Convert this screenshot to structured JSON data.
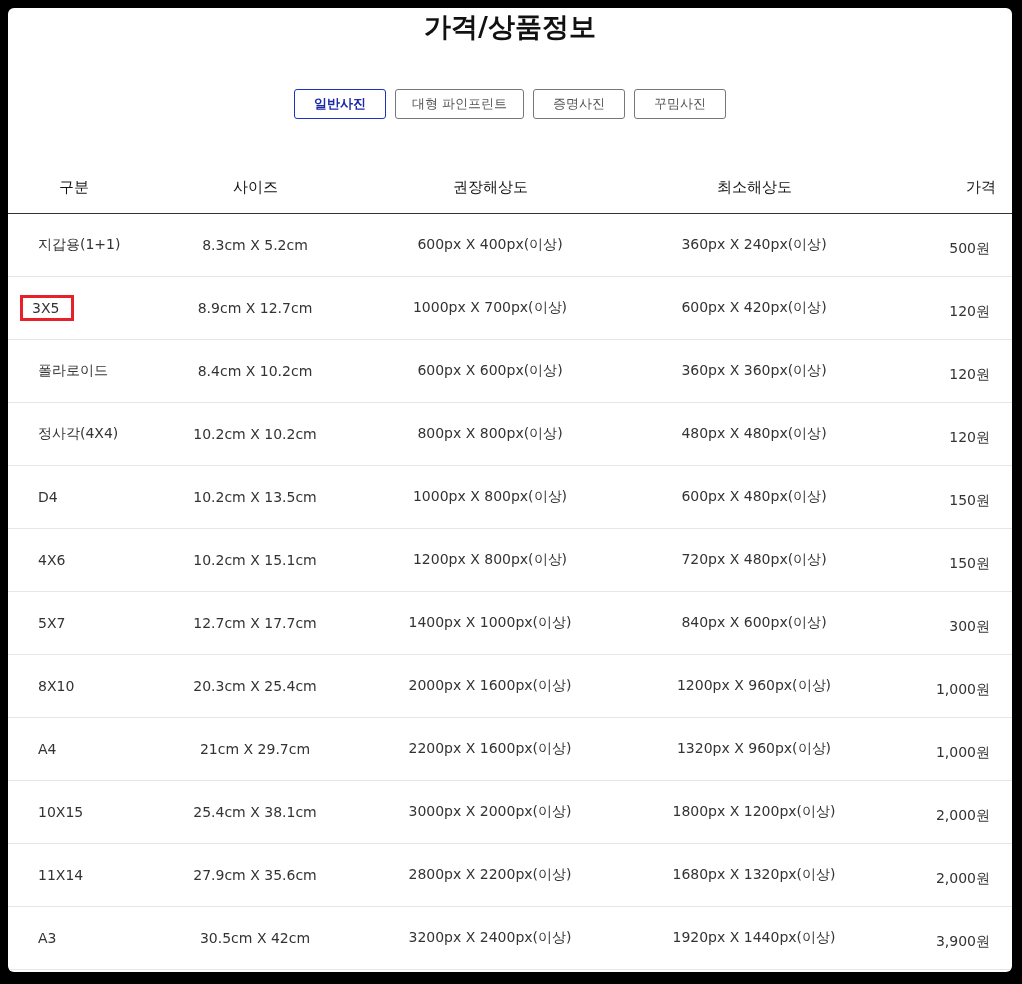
{
  "title": "가격/상품정보",
  "tabs": [
    {
      "label": "일반사진",
      "selected": true
    },
    {
      "label": "대형 파인프린트",
      "selected": false
    },
    {
      "label": "증명사진",
      "selected": false
    },
    {
      "label": "꾸밈사진",
      "selected": false
    }
  ],
  "table": {
    "columns": [
      "구분",
      "사이즈",
      "권장해상도",
      "최소해상도",
      "가격"
    ],
    "rows": [
      {
        "cells": [
          "지갑용(1+1)",
          "8.3cm X 5.2cm",
          "600px X 400px(이상)",
          "360px X 240px(이상)",
          "500원"
        ],
        "highlighted": false
      },
      {
        "cells": [
          "3X5",
          "8.9cm X 12.7cm",
          "1000px X 700px(이상)",
          "600px X 420px(이상)",
          "120원"
        ],
        "highlighted": true
      },
      {
        "cells": [
          "폴라로이드",
          "8.4cm X 10.2cm",
          "600px X 600px(이상)",
          "360px X 360px(이상)",
          "120원"
        ],
        "highlighted": false
      },
      {
        "cells": [
          "정사각(4X4)",
          "10.2cm X 10.2cm",
          "800px X 800px(이상)",
          "480px X 480px(이상)",
          "120원"
        ],
        "highlighted": false
      },
      {
        "cells": [
          "D4",
          "10.2cm X 13.5cm",
          "1000px X 800px(이상)",
          "600px X 480px(이상)",
          "150원"
        ],
        "highlighted": false
      },
      {
        "cells": [
          "4X6",
          "10.2cm X 15.1cm",
          "1200px X 800px(이상)",
          "720px X 480px(이상)",
          "150원"
        ],
        "highlighted": false
      },
      {
        "cells": [
          "5X7",
          "12.7cm X 17.7cm",
          "1400px X 1000px(이상)",
          "840px X 600px(이상)",
          "300원"
        ],
        "highlighted": false
      },
      {
        "cells": [
          "8X10",
          "20.3cm X 25.4cm",
          "2000px X 1600px(이상)",
          "1200px X 960px(이상)",
          "1,000원"
        ],
        "highlighted": false
      },
      {
        "cells": [
          "A4",
          "21cm X 29.7cm",
          "2200px X 1600px(이상)",
          "1320px X 960px(이상)",
          "1,000원"
        ],
        "highlighted": false
      },
      {
        "cells": [
          "10X15",
          "25.4cm X 38.1cm",
          "3000px X 2000px(이상)",
          "1800px X 1200px(이상)",
          "2,000원"
        ],
        "highlighted": false
      },
      {
        "cells": [
          "11X14",
          "27.9cm X 35.6cm",
          "2800px X 2200px(이상)",
          "1680px X 1320px(이상)",
          "2,000원"
        ],
        "highlighted": false
      },
      {
        "cells": [
          "A3",
          "30.5cm X 42cm",
          "3200px X 2400px(이상)",
          "1920px X 1440px(이상)",
          "3,900원"
        ],
        "highlighted": false
      }
    ]
  }
}
